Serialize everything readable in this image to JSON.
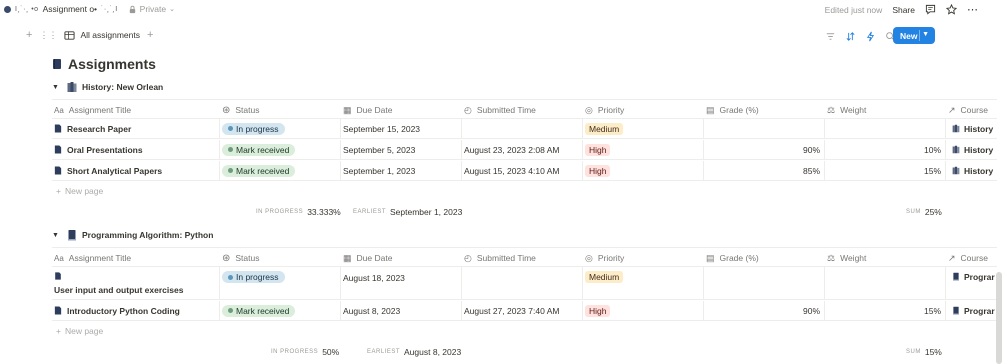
{
  "topbar": {
    "breadcrumb_scribble_1": "I¸˙·¸ •o",
    "breadcrumb_title": "Assignment o•",
    "breadcrumb_scribble_2": "˙·¸˙¸I",
    "privacy": "Private",
    "edited": "Edited just now",
    "share": "Share"
  },
  "viewbar": {
    "tab_label": "All assignments",
    "new_label": "New"
  },
  "database": {
    "title": "Assignments"
  },
  "columns": {
    "title": "Assignment Title",
    "status": "Status",
    "due": "Due Date",
    "submitted": "Submitted Time",
    "priority": "Priority",
    "grade": "Grade (%)",
    "weight": "Weight",
    "course": "Course"
  },
  "groups": [
    {
      "name": "History: New Orlean",
      "rows": [
        {
          "title": "Research Paper",
          "status": "In progress",
          "due": "September 15, 2023",
          "submitted": "",
          "priority": "Medium",
          "grade": "",
          "weight": "",
          "course": "History"
        },
        {
          "title": "Oral Presentations",
          "status": "Mark received",
          "due": "September 5, 2023",
          "submitted": "August 23, 2023 2:08 AM",
          "priority": "High",
          "grade": "90%",
          "weight": "10%",
          "course": "History"
        },
        {
          "title": "Short Analytical Papers",
          "status": "Mark received",
          "due": "September 1, 2023",
          "submitted": "August 15, 2023 4:10 AM",
          "priority": "High",
          "grade": "85%",
          "weight": "15%",
          "course": "History"
        }
      ],
      "new_page": "New page",
      "calc": {
        "in_progress_label": "IN PROGRESS",
        "in_progress": "33.333%",
        "earliest_label": "EARLIEST",
        "earliest": "September 1, 2023",
        "sum_label": "SUM",
        "sum": "25%"
      }
    },
    {
      "name": "Programming Algorithm: Python",
      "rows": [
        {
          "title": "User input and output exercises",
          "status": "In progress",
          "due": "August 18, 2023",
          "submitted": "",
          "priority": "Medium",
          "grade": "",
          "weight": "",
          "course": "Prograr"
        },
        {
          "title": "Introductory Python Coding",
          "status": "Mark received",
          "due": "August 8, 2023",
          "submitted": "August 27, 2023 7:40 AM",
          "priority": "High",
          "grade": "90%",
          "weight": "15%",
          "course": "Prograr"
        }
      ],
      "new_page": "New page",
      "calc": {
        "in_progress_label": "IN PROGRESS",
        "in_progress": "50%",
        "earliest_label": "EARLIEST",
        "earliest": "August 8, 2023",
        "sum_label": "SUM",
        "sum": "15%"
      }
    }
  ],
  "colors": {
    "accent": "#2383e2",
    "in_progress_dot": "#5b97bd",
    "mark_received_dot": "#6c9b7d"
  }
}
